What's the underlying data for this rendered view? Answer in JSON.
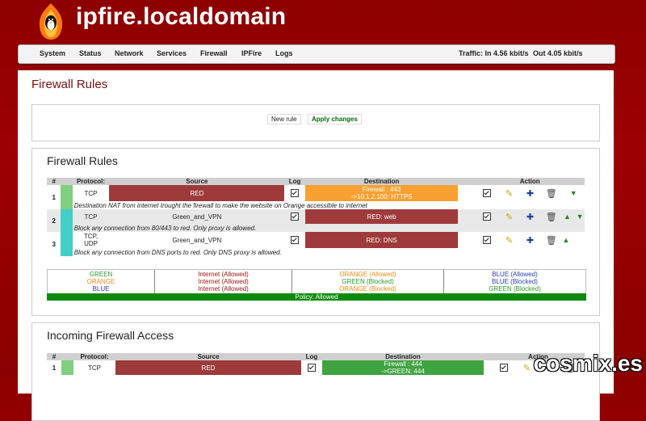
{
  "header": {
    "title": "ipfire.localdomain"
  },
  "menu": {
    "items": [
      "System",
      "Status",
      "Network",
      "Services",
      "Firewall",
      "IPFire",
      "Logs"
    ],
    "traffic_in": "Traffic: In 4.56 kbit/s",
    "traffic_out": "Out 4.05 kbit/s"
  },
  "page": {
    "title": "Firewall Rules"
  },
  "toolbar": {
    "new_rule": "New rule",
    "apply_changes": "Apply changes"
  },
  "rules_section": {
    "title": "Firewall Rules",
    "headers": [
      "#",
      "Protocol:",
      "Source",
      "Log",
      "Destination",
      "Action"
    ],
    "rules": [
      {
        "num": "1",
        "protocol": "TCP",
        "source": "RED",
        "dest_line1": "Firewall : 443",
        "dest_line2": "->10.1.2.100: HTTPS",
        "desc": "Destination NAT from internet trought the firewall to make the website on Orange accessible to internet"
      },
      {
        "num": "2",
        "protocol": "TCP",
        "source": "Green_and_VPN",
        "dest_line1": "RED: web",
        "desc": "Block any connection from 80/443 to red. Only proxy is allowed."
      },
      {
        "num": "3",
        "protocol_line1": "TCP,",
        "protocol_line2": "UDP",
        "source": "Green_and_VPN",
        "dest_line1": "RED: DNS",
        "desc": "Block any connection from DNS ports to red. Only DNS proxy is allowed."
      }
    ],
    "legend": {
      "col1": [
        "GREEN",
        "ORANGE",
        "BLUE"
      ],
      "col2": [
        "Internet (Allowed)",
        "Internet (Allowed)",
        "Internet (Allowed)"
      ],
      "col3": [
        "ORANGE (Allowed)",
        "GREEN (Blocked)",
        "ORANGE (Blocked)"
      ],
      "col4": [
        "BLUE (Allowed)",
        "BLUE (Blocked)",
        "GREEN (Blocked)"
      ]
    },
    "policy": "Policy: Allowed"
  },
  "incoming_section": {
    "title": "Incoming Firewall Access",
    "headers": [
      "#",
      "Protocol:",
      "Source",
      "Log",
      "Destination",
      "Action"
    ],
    "rules": [
      {
        "num": "1",
        "protocol": "TCP",
        "source": "RED",
        "dest_line1": "Firewall : 444",
        "dest_line2": "->GREEN: 444"
      }
    ]
  },
  "watermark": "cosmix.es",
  "colors": {
    "red_zone": "#9e3a3a",
    "orange_zone": "#f8a030",
    "green_zone": "#3fa33f",
    "green_bar": "#7fd07f",
    "teal_bar": "#40d0c8",
    "policy": "#0f8a0f"
  },
  "icons": [
    "logo-flame-penguin",
    "checkbox-icon",
    "pencil-icon",
    "add-user-icon",
    "trash-icon",
    "arrow-up-icon",
    "arrow-down-icon"
  ]
}
